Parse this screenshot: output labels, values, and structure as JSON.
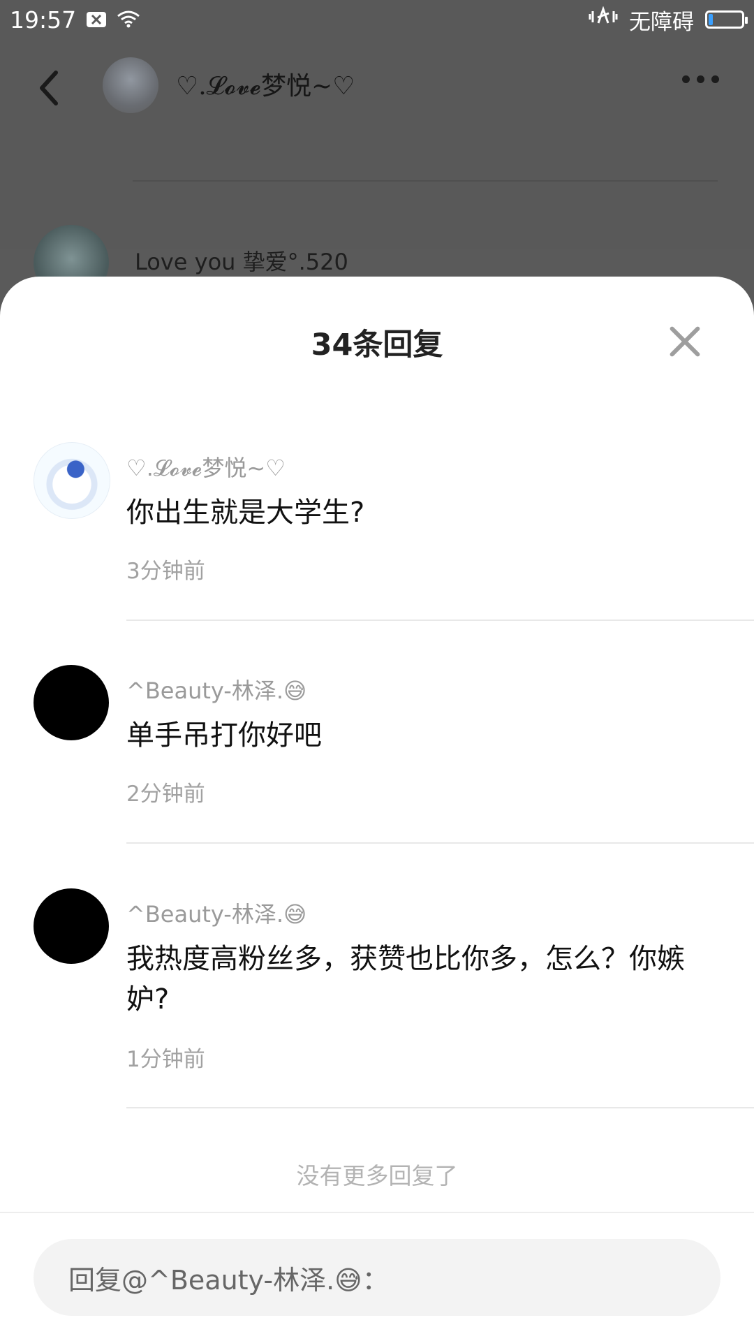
{
  "status_bar": {
    "time": "19:57",
    "mute_icon": "silent-sim-icon",
    "wifi_icon": "wifi-icon",
    "vibrate_icon": "vibrate-icon",
    "accessibility_label": "无障碍",
    "battery_icon": "battery-icon"
  },
  "background_page": {
    "title": "♡.𝓛𝓸𝓿𝓮梦悦~♡",
    "comment_author": "Love you 挚爱°.520",
    "back_icon": "back-arrow-icon",
    "more_icon": "more-dots-icon"
  },
  "sheet": {
    "title": "34条回复",
    "close_icon": "close-icon",
    "replies": [
      {
        "name": "♡.𝓛𝓸𝓿𝓮梦悦~♡",
        "text": "你出生就是大学生?",
        "time": "3分钟前"
      },
      {
        "name": "^Beauty-林泽.😅",
        "text": "单手吊打你好吧",
        "time": "2分钟前"
      },
      {
        "name": "^Beauty-林泽.😅",
        "text": "我热度高粉丝多，获赞也比你多，怎么？你嫉妒?",
        "time": "1分钟前"
      }
    ],
    "no_more": "没有更多回复了",
    "input_placeholder": "回复@^Beauty-林泽.😅："
  }
}
